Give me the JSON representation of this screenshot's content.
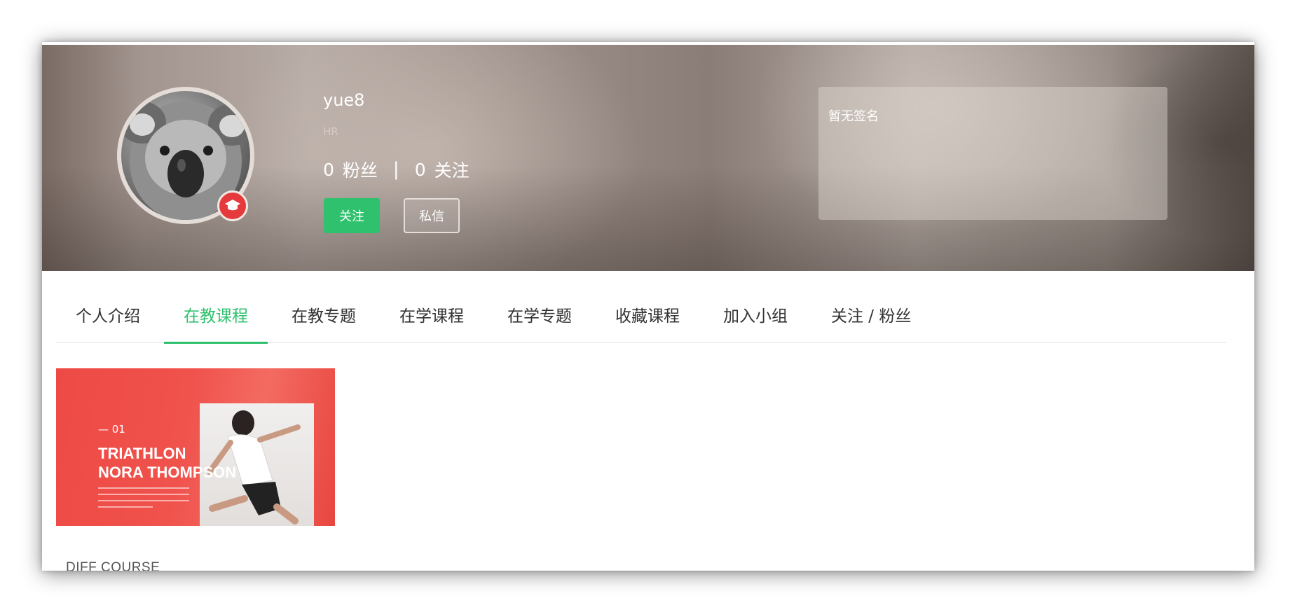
{
  "profile": {
    "username": "yue8",
    "role": "HR",
    "followers_count": "0",
    "followers_label": "粉丝",
    "separator": "|",
    "following_count": "0",
    "following_label": "关注",
    "follow_button": "关注",
    "message_button": "私信",
    "signature": "暂无签名",
    "badge_icon": "graduation-cap-icon"
  },
  "tabs": [
    {
      "label": "个人介绍",
      "active": false
    },
    {
      "label": "在教课程",
      "active": true
    },
    {
      "label": "在教专题",
      "active": false
    },
    {
      "label": "在学课程",
      "active": false
    },
    {
      "label": "在学专题",
      "active": false
    },
    {
      "label": "收藏课程",
      "active": false
    },
    {
      "label": "加入小组",
      "active": false
    },
    {
      "label": "关注 / 粉丝",
      "active": false
    }
  ],
  "course": {
    "thumb_number": "— 01",
    "thumb_title": "TRIATHLON\nNORA THOMPSON",
    "name": "DIFF COURSE"
  },
  "colors": {
    "accent": "#2fc16d",
    "badge": "#e5393b",
    "card": "#ee4a45"
  }
}
